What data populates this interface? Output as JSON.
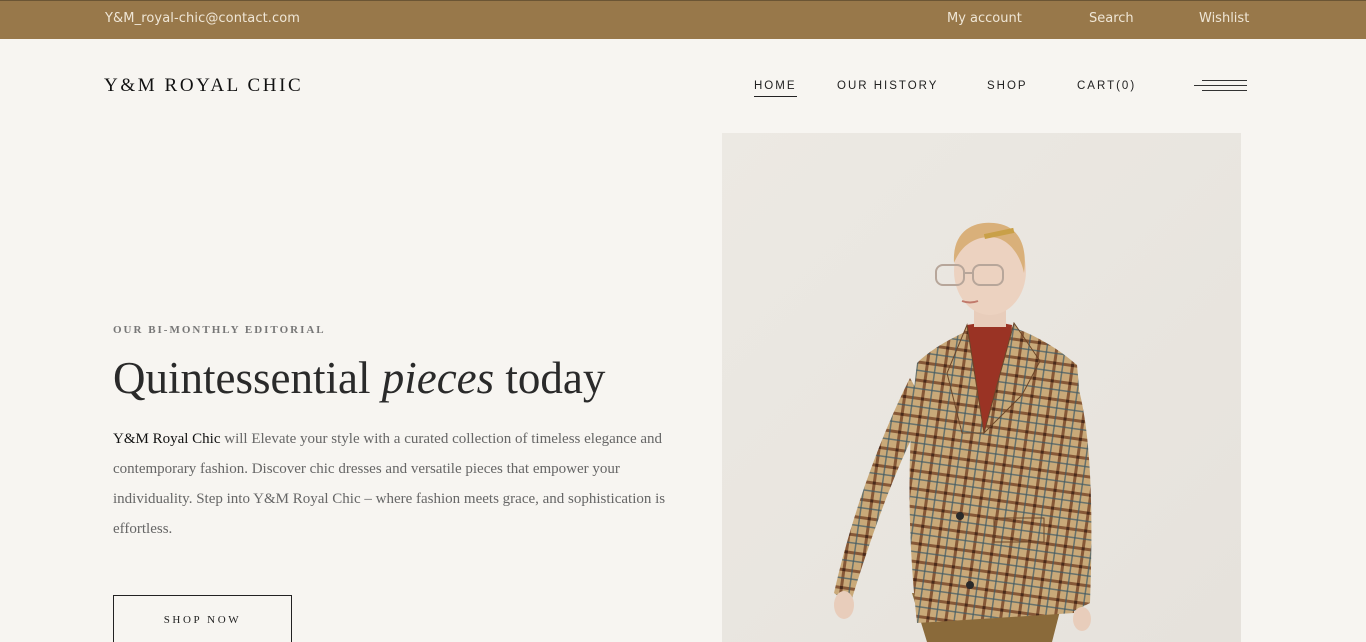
{
  "topbar": {
    "email": "Y&M_royal-chic@contact.com",
    "links": [
      "My account",
      "Search",
      "Wishlist"
    ]
  },
  "header": {
    "logo": "Y&M ROYAL CHIC",
    "nav": [
      "HOME",
      "OUR HISTORY",
      "SHOP",
      "CART(0)"
    ],
    "menu_icon": "hamburger-icon"
  },
  "hero": {
    "kicker": "OUR BI-MONTHLY EDITORIAL",
    "title_start": "Quintessential ",
    "title_italic": "pieces",
    "title_end": " today",
    "brand": "Y&M Royal Chic",
    "description": " will Elevate your style with a curated collection of timeless elegance and contemporary fashion. Discover chic dresses and versatile pieces that empower your individuality. Step into Y&M Royal Chic – where fashion meets grace, and sophistication is effortless.",
    "cta": "SHOP NOW"
  },
  "colors": {
    "topbar_bg": "#98784a",
    "page_bg": "#f7f5f1"
  }
}
